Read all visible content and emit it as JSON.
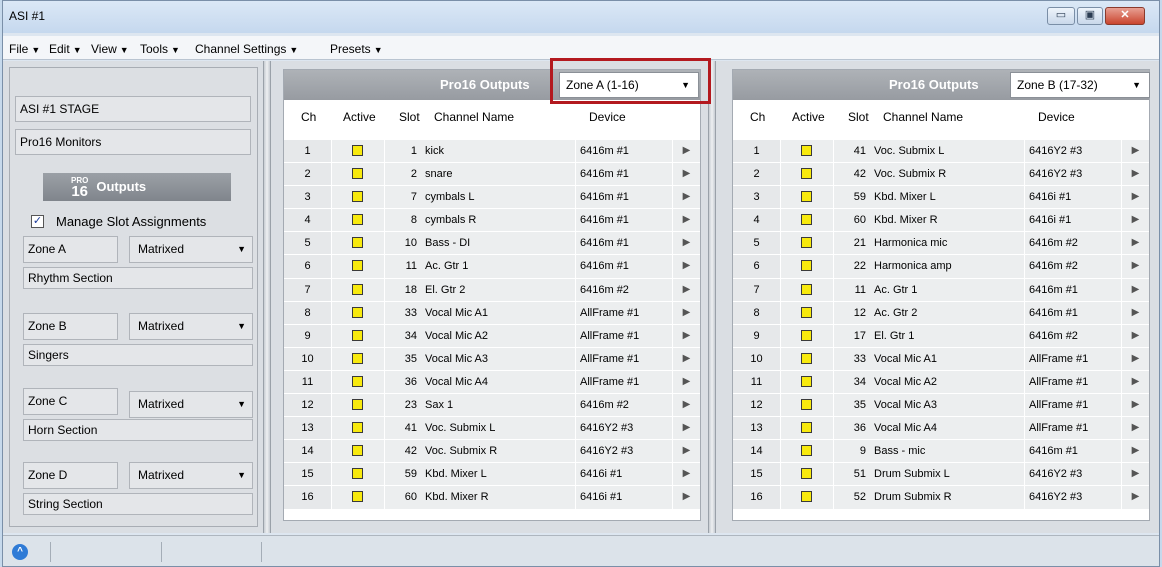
{
  "window": {
    "title": "ASI #1",
    "min": "▭",
    "max": "▣",
    "close": "✕"
  },
  "menu": [
    {
      "label": "File",
      "arrow": "▼"
    },
    {
      "label": "Edit",
      "arrow": "▼"
    },
    {
      "label": "View",
      "arrow": "▼"
    },
    {
      "label": "Tools",
      "arrow": "▼"
    },
    {
      "label": "Channel Settings",
      "arrow": "▼"
    },
    {
      "label": "Presets",
      "arrow": "▼"
    }
  ],
  "left": {
    "name": "ASI #1 STAGE",
    "desc": "Pro16 Monitors",
    "logo_pro": "PRO",
    "logo_num": "16",
    "logo_label": "Outputs",
    "manage_check": "✓",
    "manage_label": "Manage Slot Assignments",
    "zones": [
      {
        "name": "Zone A",
        "mode": "Matrixed",
        "desc": "Rhythm Section"
      },
      {
        "name": "Zone B",
        "mode": "Matrixed",
        "desc": "Singers"
      },
      {
        "name": "Zone C",
        "mode": "Matrixed",
        "desc": "Horn Section"
      },
      {
        "name": "Zone D",
        "mode": "Matrixed",
        "desc": "String Section"
      }
    ]
  },
  "columns": {
    "ch": "Ch",
    "active": "Active",
    "slot": "Slot",
    "name": "Channel Name",
    "device": "Device"
  },
  "panels": [
    {
      "title": "Pro16 Outputs",
      "zone": "Zone A  (1-16)",
      "rows": [
        {
          "ch": "1",
          "slot": "1",
          "name": "kick",
          "device": "6416m #1"
        },
        {
          "ch": "2",
          "slot": "2",
          "name": "snare",
          "device": "6416m #1"
        },
        {
          "ch": "3",
          "slot": "7",
          "name": "cymbals L",
          "device": "6416m #1"
        },
        {
          "ch": "4",
          "slot": "8",
          "name": "cymbals R",
          "device": "6416m #1"
        },
        {
          "ch": "5",
          "slot": "10",
          "name": "Bass - DI",
          "device": "6416m #1"
        },
        {
          "ch": "6",
          "slot": "11",
          "name": "Ac. Gtr 1",
          "device": "6416m #1"
        },
        {
          "ch": "7",
          "slot": "18",
          "name": "El. Gtr 2",
          "device": "6416m #2"
        },
        {
          "ch": "8",
          "slot": "33",
          "name": "Vocal Mic A1",
          "device": "AllFrame #1"
        },
        {
          "ch": "9",
          "slot": "34",
          "name": "Vocal Mic A2",
          "device": "AllFrame #1"
        },
        {
          "ch": "10",
          "slot": "35",
          "name": "Vocal Mic A3",
          "device": "AllFrame #1"
        },
        {
          "ch": "11",
          "slot": "36",
          "name": "Vocal Mic A4",
          "device": "AllFrame #1"
        },
        {
          "ch": "12",
          "slot": "23",
          "name": "Sax 1",
          "device": "6416m #2"
        },
        {
          "ch": "13",
          "slot": "41",
          "name": "Voc. Submix L",
          "device": "6416Y2 #3"
        },
        {
          "ch": "14",
          "slot": "42",
          "name": "Voc. Submix R",
          "device": "6416Y2 #3"
        },
        {
          "ch": "15",
          "slot": "59",
          "name": "Kbd. Mixer L",
          "device": "6416i #1"
        },
        {
          "ch": "16",
          "slot": "60",
          "name": "Kbd. Mixer R",
          "device": "6416i #1"
        }
      ]
    },
    {
      "title": "Pro16 Outputs",
      "zone": "Zone B  (17-32)",
      "rows": [
        {
          "ch": "1",
          "slot": "41",
          "name": "Voc. Submix L",
          "device": "6416Y2 #3"
        },
        {
          "ch": "2",
          "slot": "42",
          "name": "Voc. Submix R",
          "device": "6416Y2 #3"
        },
        {
          "ch": "3",
          "slot": "59",
          "name": "Kbd. Mixer L",
          "device": "6416i #1"
        },
        {
          "ch": "4",
          "slot": "60",
          "name": "Kbd. Mixer R",
          "device": "6416i #1"
        },
        {
          "ch": "5",
          "slot": "21",
          "name": "Harmonica mic",
          "device": "6416m #2"
        },
        {
          "ch": "6",
          "slot": "22",
          "name": "Harmonica amp",
          "device": "6416m #2"
        },
        {
          "ch": "7",
          "slot": "11",
          "name": "Ac. Gtr 1",
          "device": "6416m #1"
        },
        {
          "ch": "8",
          "slot": "12",
          "name": "Ac. Gtr 2",
          "device": "6416m #1"
        },
        {
          "ch": "9",
          "slot": "17",
          "name": "El. Gtr 1",
          "device": "6416m #2"
        },
        {
          "ch": "10",
          "slot": "33",
          "name": "Vocal Mic A1",
          "device": "AllFrame #1"
        },
        {
          "ch": "11",
          "slot": "34",
          "name": "Vocal Mic A2",
          "device": "AllFrame #1"
        },
        {
          "ch": "12",
          "slot": "35",
          "name": "Vocal Mic A3",
          "device": "AllFrame #1"
        },
        {
          "ch": "13",
          "slot": "36",
          "name": "Vocal Mic A4",
          "device": "AllFrame #1"
        },
        {
          "ch": "14",
          "slot": "9",
          "name": "Bass - mic",
          "device": "6416m #1"
        },
        {
          "ch": "15",
          "slot": "51",
          "name": "Drum Submix L",
          "device": "6416Y2 #3"
        },
        {
          "ch": "16",
          "slot": "52",
          "name": "Drum Submix R",
          "device": "6416Y2 #3"
        }
      ]
    }
  ],
  "icons": {
    "dropdown": "▼",
    "row_arrow": "▶",
    "status": "^"
  },
  "colors": {
    "active_indicator": "#f8ea0e",
    "highlight": "#b3191f",
    "panel_header": "#979ba1"
  }
}
